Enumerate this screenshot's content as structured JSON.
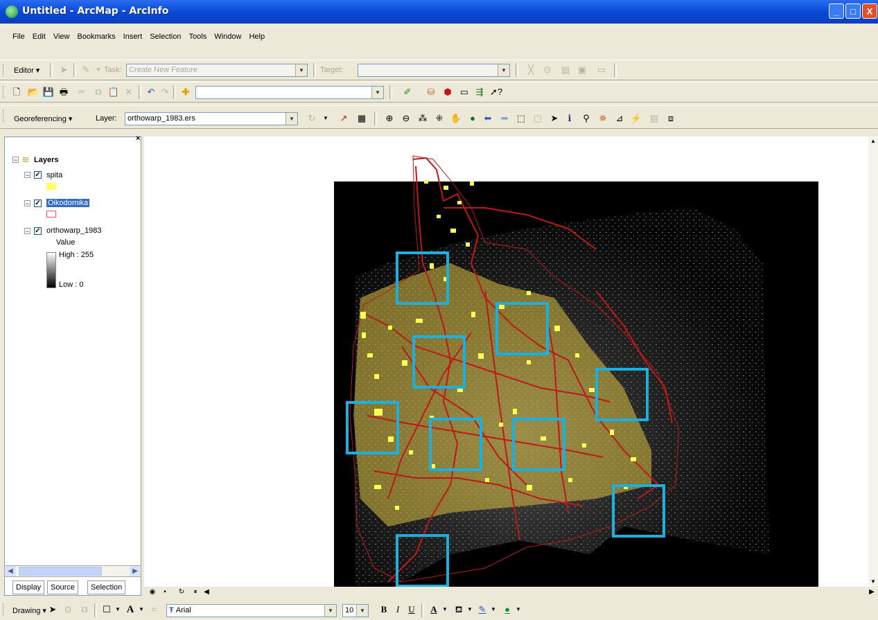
{
  "window": {
    "title": "Untitled - ArcMap - ArcInfo",
    "min": "_",
    "max": "□",
    "close": "X"
  },
  "menu": [
    "File",
    "Edit",
    "View",
    "Bookmarks",
    "Insert",
    "Selection",
    "Tools",
    "Window",
    "Help"
  ],
  "editor": {
    "label": "Editor ▾",
    "task_label": "Task:",
    "task_value": "Create New Feature",
    "target_label": "Target:",
    "target_value": ""
  },
  "georef": {
    "label": "Georeferencing ▾",
    "layer_label": "Layer:",
    "layer_value": "orthowarp_1983.ers"
  },
  "standard": {
    "scale_value": ""
  },
  "toc": {
    "root": "Layers",
    "layers": [
      {
        "name": "spita",
        "swatch": "#ffff66"
      },
      {
        "name": "Oikodomika",
        "swatch": "#ff6666"
      },
      {
        "name": "orthowarp_1983",
        "legend_title": "Value",
        "high": "High : 255",
        "low": "Low : 0"
      }
    ],
    "tabs": [
      "Display",
      "Source",
      "Selection"
    ]
  },
  "drawing": {
    "label": "Drawing ▾",
    "font": "Arial",
    "size": "10",
    "bold": "B",
    "italic": "I",
    "underline": "U"
  },
  "colors": {
    "highlight_boxes": "#1ab0e0",
    "buildings": "#ffff55",
    "roads": "#c01818"
  }
}
